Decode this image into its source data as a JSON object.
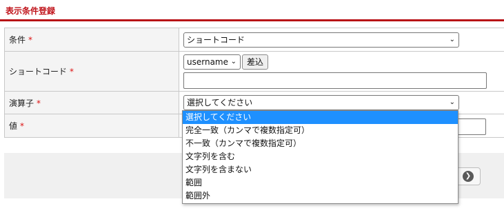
{
  "header": {
    "title": "表示条件登録"
  },
  "form": {
    "required_mark": "*",
    "rows": [
      {
        "label": "条件",
        "value": "ショートコード"
      },
      {
        "label": "ショートコード",
        "select_value": "username",
        "insert_button": "差込"
      },
      {
        "label": "演算子",
        "value": "選択してください"
      },
      {
        "label": "値"
      }
    ]
  },
  "dropdown": {
    "options": [
      "選択してください",
      "完全一致（カンマで複数指定可）",
      "不一致（カンマで複数指定可）",
      "文字列を含む",
      "文字列を含まない",
      "範囲",
      "範囲外"
    ],
    "highlighted_index": 0
  },
  "icons": {
    "select_arrow": "chevron-down-icon",
    "nav": "arrow-right-circle-icon"
  }
}
